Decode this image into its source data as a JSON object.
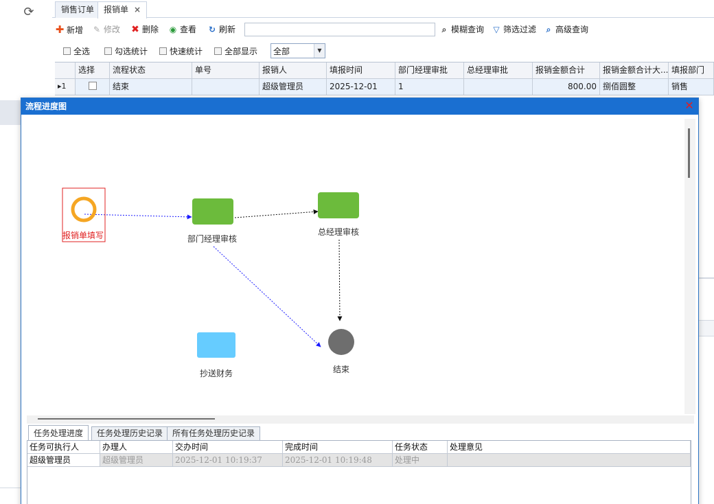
{
  "tabs": [
    {
      "label": "销售订单"
    },
    {
      "label": "报销单",
      "close": "×"
    }
  ],
  "toolbar": {
    "new": "新增",
    "edit": "修改",
    "delete": "删除",
    "view": "查看",
    "refresh": "刷新",
    "search_value": "",
    "fuzzy": "模糊查询",
    "filter": "筛选过滤",
    "advanced": "高级查询"
  },
  "options": {
    "select_all": "全选",
    "check_stat": "勾选统计",
    "quick_stat": "快速统计",
    "show_all": "全部显示",
    "scope_value": "全部"
  },
  "grid": {
    "headers": [
      "选择",
      "流程状态",
      "单号",
      "报销人",
      "填报时间",
      "部门经理审批",
      "总经理审批",
      "报销金额合计",
      "报销金额合计大...",
      "填报部门"
    ],
    "row": {
      "indicator": "▸1",
      "status": "结束",
      "number": "",
      "person": "超级管理员",
      "date": "2025-12-01",
      "dept_approval": "1",
      "gm_approval": "",
      "amount": "800.00",
      "amount_cn": "捌佰圆整",
      "dept": "销售"
    }
  },
  "dialog": {
    "title": "流程进度图",
    "close": "✕",
    "nodes": {
      "start": "报销单填写",
      "dept": "部门经理审核",
      "gm": "总经理审核",
      "cc": "抄送财务",
      "end": "结束"
    },
    "colors": {
      "start_ring": "#f5a623",
      "start_box": "#e02020",
      "task": "#6cbb3c",
      "cc": "#66ccff",
      "end": "#6e6e6e",
      "flow_done": "#1a1aff",
      "flow_pending": "#111111"
    },
    "bottom_tabs": [
      "任务处理进度",
      "任务处理历史记录",
      "所有任务处理历史记录"
    ],
    "task_table": {
      "headers": [
        "任务可执行人",
        "办理人",
        "交办时间",
        "完成时间",
        "任务状态",
        "处理意见"
      ],
      "row": [
        "超级管理员",
        "超级管理员",
        "2025-12-01 10:19:37",
        "2025-12-01 10:19:48",
        "处理中",
        ""
      ]
    }
  }
}
